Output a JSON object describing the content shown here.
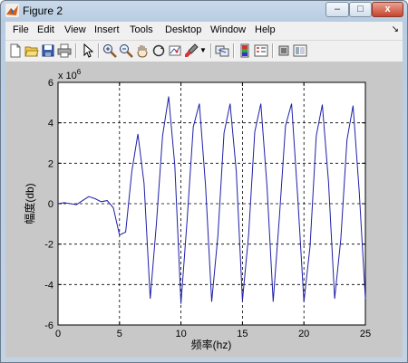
{
  "window": {
    "title": "Figure 2",
    "minimize_label": "–",
    "maximize_label": "□",
    "close_label": "x"
  },
  "menu": {
    "items": [
      "File",
      "Edit",
      "View",
      "Insert",
      "Tools",
      "Desktop",
      "Window",
      "Help"
    ],
    "dock_arrow": "↘"
  },
  "toolbar": {
    "tools": [
      "new-figure",
      "open-file",
      "save",
      "print",
      "edit-plot",
      "zoom-in",
      "zoom-out",
      "pan",
      "rotate-3d",
      "data-cursor",
      "brush",
      "link-plot",
      "insert-colorbar",
      "insert-legend",
      "hide-plot-tools",
      "show-plot-tools"
    ]
  },
  "colors": {
    "line": "#1f1fa8",
    "grid": "#000000",
    "figure_bg": "#c8c8c8"
  },
  "chart_data": {
    "type": "line",
    "xlabel": "频率(hz)",
    "ylabel": "幅度(db)",
    "title": "",
    "xlim": [
      0,
      25
    ],
    "ylim": [
      -6,
      6
    ],
    "xticks": [
      0,
      5,
      10,
      15,
      20,
      25
    ],
    "yticks": [
      -6,
      -4,
      -2,
      0,
      2,
      4,
      6
    ],
    "y_exponent_label": "x 10",
    "y_exponent_power": "6",
    "grid": true,
    "series": [
      {
        "x": [
          0,
          0.5,
          1,
          1.5,
          2,
          2.5,
          3,
          3.5,
          4,
          4.5,
          5,
          5.5,
          6,
          6.5,
          7,
          7.5,
          8,
          8.5,
          9,
          9.5,
          10,
          10.5,
          11,
          11.5,
          12,
          12.5,
          13,
          13.5,
          14,
          14.5,
          15,
          15.5,
          16,
          16.5,
          17,
          17.5,
          18,
          18.5,
          19,
          19.5,
          20,
          20.5,
          21,
          21.5,
          22,
          22.5,
          23,
          23.5,
          24,
          24.5,
          25
        ],
        "y": [
          0,
          0.05,
          0,
          -0.05,
          0.15,
          0.35,
          0.25,
          0.1,
          0.15,
          -0.2,
          -1.55,
          -1.4,
          1.6,
          3.45,
          1.0,
          -4.7,
          -1.0,
          3.35,
          5.3,
          1.9,
          -4.95,
          -0.8,
          3.8,
          4.95,
          0.9,
          -4.85,
          -1.6,
          3.5,
          4.95,
          1.6,
          -4.8,
          -1.55,
          3.55,
          4.95,
          0.85,
          -4.85,
          -0.7,
          3.85,
          4.95,
          0.3,
          -4.85,
          -2.1,
          3.35,
          4.9,
          1.1,
          -4.7,
          -1.75,
          3.15,
          4.85,
          0.6,
          -4.7
        ]
      }
    ]
  }
}
